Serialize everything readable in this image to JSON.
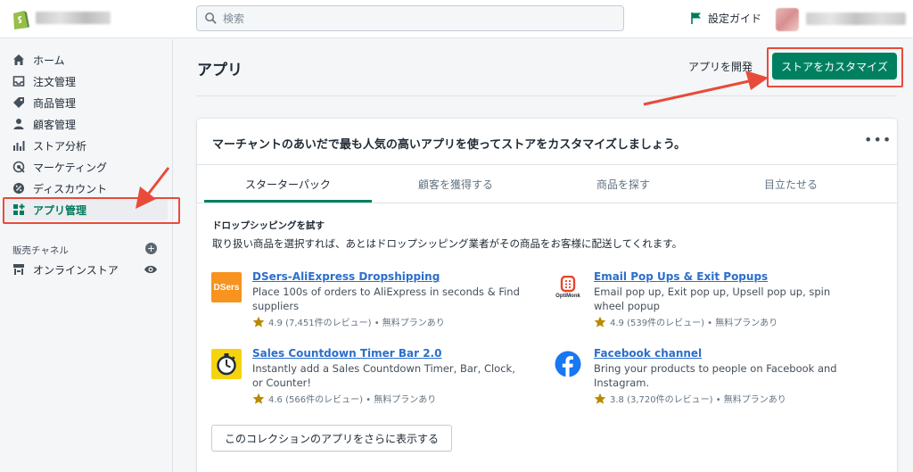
{
  "header": {
    "search_placeholder": "検索",
    "setup_guide": "設定ガイド"
  },
  "sidebar": {
    "items": [
      {
        "label": "ホーム",
        "icon": "home-icon"
      },
      {
        "label": "注文管理",
        "icon": "orders-icon"
      },
      {
        "label": "商品管理",
        "icon": "tag-icon"
      },
      {
        "label": "顧客管理",
        "icon": "customer-icon"
      },
      {
        "label": "ストア分析",
        "icon": "analytics-icon"
      },
      {
        "label": "マーケティング",
        "icon": "marketing-icon"
      },
      {
        "label": "ディスカウント",
        "icon": "discount-icon"
      },
      {
        "label": "アプリ管理",
        "icon": "apps-icon",
        "active": true
      }
    ],
    "sales_channels_title": "販売チャネル",
    "channel": {
      "label": "オンラインストア",
      "icon": "store-icon"
    }
  },
  "main": {
    "title": "アプリ",
    "develop_link": "アプリを開発",
    "customize_button": "ストアをカスタマイズ",
    "card": {
      "title": "マーチャントのあいだで最も人気の高いアプリを使ってストアをカスタマイズしましょう。",
      "tabs": [
        {
          "label": "スターターパック",
          "active": true
        },
        {
          "label": "顧客を獲得する"
        },
        {
          "label": "商品を探す"
        },
        {
          "label": "目立たせる"
        }
      ],
      "collection_title": "ドロップシッピングを試す",
      "collection_desc": "取り扱い商品を選択すれば、あとはドロップシッピング業者がその商品をお客様に配送してくれます。",
      "apps": [
        {
          "name": "DSers-AliExpress Dropshipping",
          "icon_text": "DSers",
          "desc": "Place 100s of orders to AliExpress in seconds & Find suppliers",
          "rating": "4.9 (7,451件のレビュー) • 無料プランあり"
        },
        {
          "name": "Email Pop Ups & Exit Popups",
          "icon_text": "OptiMonk",
          "desc": "Email pop up, Exit pop up, Upsell pop up, spin wheel popup",
          "rating": "4.9 (539件のレビュー) • 無料プランあり"
        },
        {
          "name": "Sales Countdown Timer Bar 2.0",
          "desc": "Instantly add a Sales Countdown Timer, Bar, Clock, or Counter!",
          "rating": "4.6 (566件のレビュー) • 無料プランあり"
        },
        {
          "name": "Facebook channel",
          "desc": "Bring your products to people on Facebook and Instagram.",
          "rating": "3.8 (3,720件のレビュー) • 無料プランあり"
        }
      ],
      "show_more_button": "このコレクションのアプリをさらに表示する"
    }
  },
  "colors": {
    "primary": "#008060",
    "link": "#2c6ecb",
    "annotation": "#e84b3a",
    "star": "#b98900"
  }
}
